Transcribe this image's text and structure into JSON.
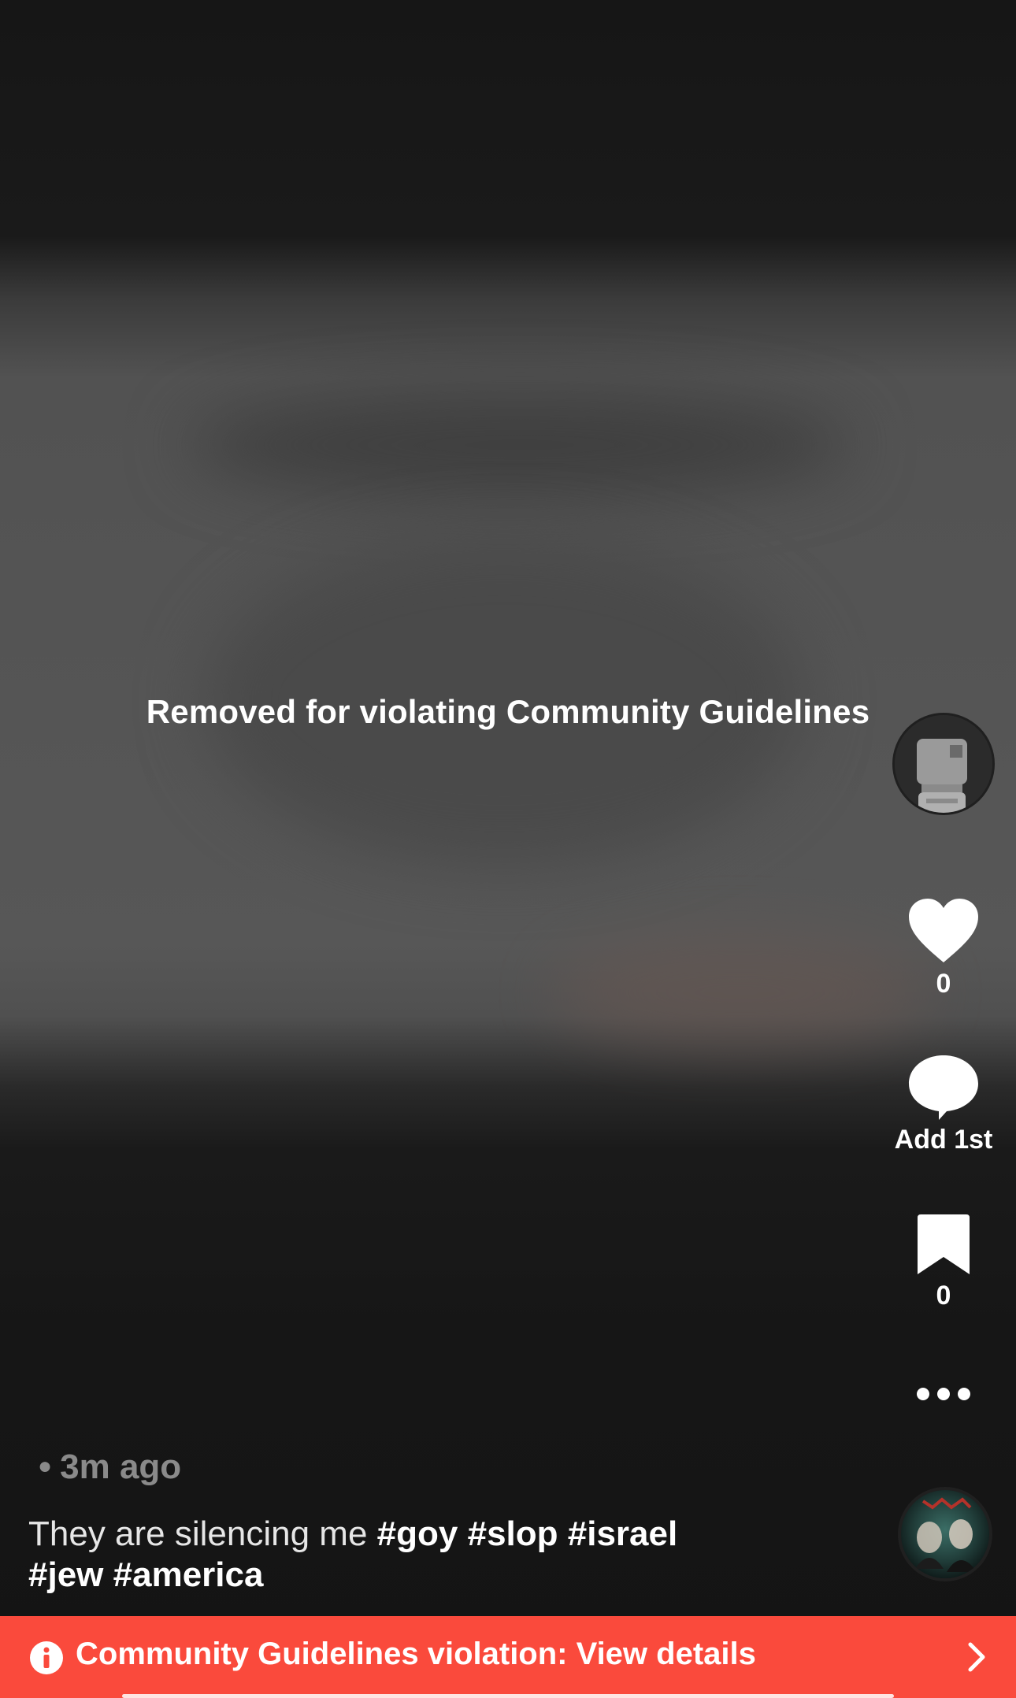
{
  "video": {
    "removed_message": "Removed for violating Community Guidelines"
  },
  "actions": {
    "likes_count": "0",
    "comment_label": "Add 1st",
    "saves_count": "0"
  },
  "post": {
    "time_ago": "3m ago",
    "caption_text": "They are silencing me",
    "hashtags": [
      "#goy",
      "#slop",
      "#israel",
      "#jew",
      "#america"
    ]
  },
  "violation_banner": {
    "text": "Community Guidelines violation: View details"
  },
  "colors": {
    "banner": "#fa4a3c",
    "background": "#161616"
  },
  "icons": {
    "avatar": "placeholder-avatar-icon",
    "like": "heart-icon",
    "comment": "comment-bubble-icon",
    "save": "bookmark-icon",
    "more": "more-dots-icon",
    "info": "info-icon",
    "chevron": "chevron-right-icon"
  }
}
